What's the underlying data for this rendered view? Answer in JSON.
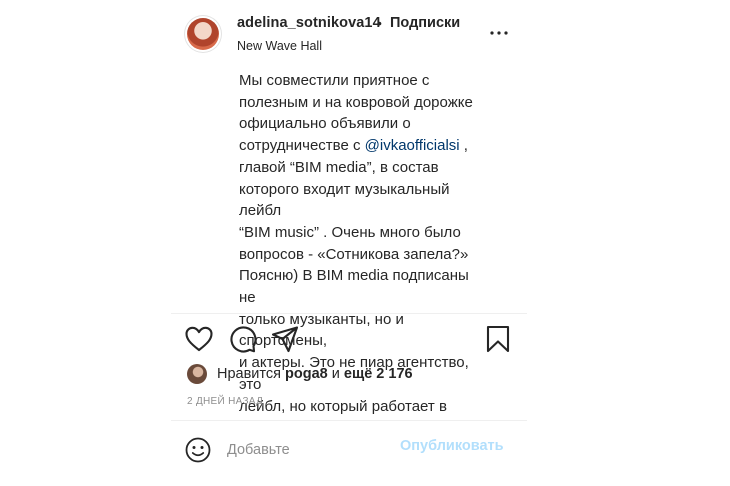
{
  "header": {
    "username": "adelina_sotnikova14",
    "separator": "•",
    "follow_label": "Подписки",
    "location": "New Wave Hall"
  },
  "caption": {
    "lines_before": "Мы совместили приятное с\nполезным и на ковровой дорожке\nофициально объявили о\nсотрудничестве с ",
    "mention": "@ivkaofficialsi",
    "lines_after": " ,\nглавой “BIM media”, в состав\nкоторого входит музыкальный лейбл\n“BIM music” . Очень много было\nвопросов - «Сотникова запела?»\nПоясню) В BIM media подписаны не\nтолько музыканты, но и спортсмены,\nи актеры. Это не пиар агентство, это\nлейбл, но который работает в"
  },
  "actions": {
    "like_icon": "heart-outline",
    "comment_icon": "speech-bubble-outline",
    "share_icon": "paper-plane-outline",
    "save_icon": "bookmark-outline"
  },
  "likes": {
    "prefix": "Нравится ",
    "user": "poga8",
    "middle": " и ",
    "count": "ещё 2 176"
  },
  "timestamp": "2 ДНЕЙ НАЗАД",
  "comment": {
    "placeholder": "Добавьте",
    "post_label": "Опубликовать"
  },
  "colors": {
    "text": "#262626",
    "secondary": "#8e8e8e",
    "mention": "#00376b",
    "post_disabled": "#b2dffc",
    "divider": "#efefef"
  }
}
